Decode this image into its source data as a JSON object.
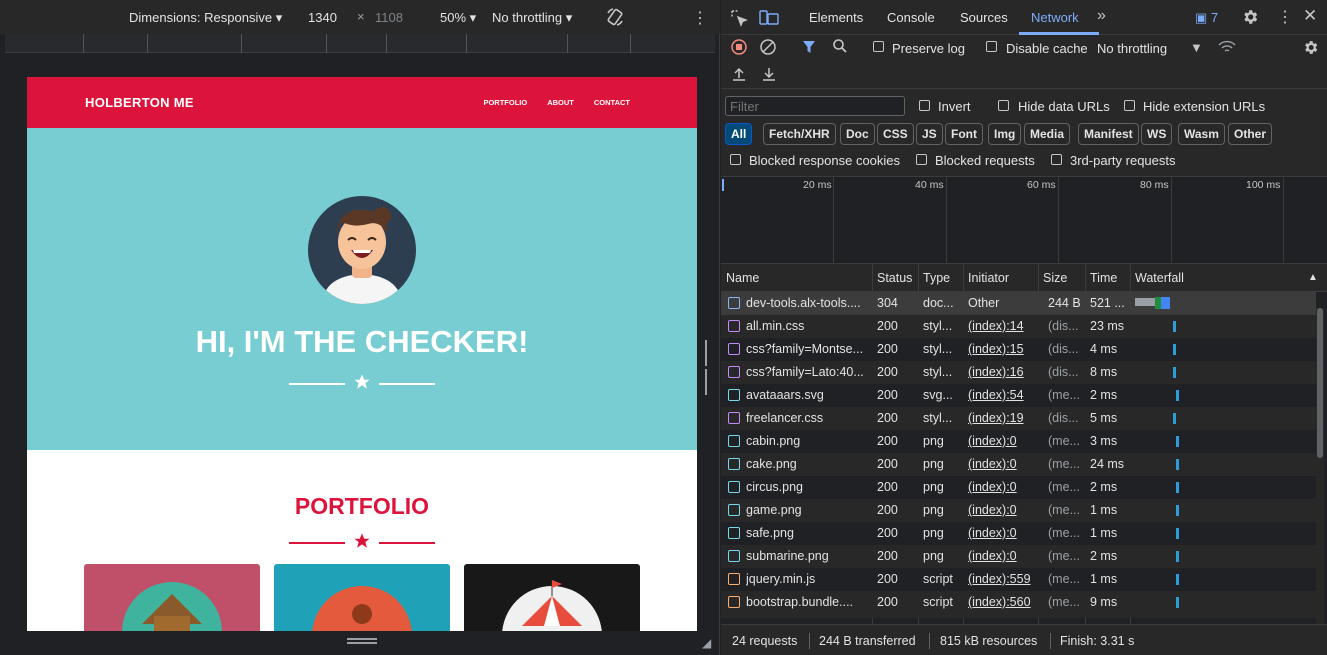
{
  "device_toolbar": {
    "dimensions_label": "Dimensions: Responsive",
    "width": "1340",
    "times": "×",
    "height": "1108",
    "zoom": "50%",
    "throttling": "No throttling"
  },
  "site": {
    "brand": "HOLBERTON ME",
    "nav": [
      "PORTFOLIO",
      "ABOUT",
      "CONTACT"
    ],
    "hero_title": "HI, I'M THE CHECKER!",
    "portfolio_title": "PORTFOLIO",
    "colors": {
      "primary": "#dc143c",
      "hero": "#78cdd2"
    }
  },
  "devtools": {
    "tabs": [
      "Elements",
      "Console",
      "Sources",
      "Network"
    ],
    "active_tab": "Network",
    "issues_count": "7",
    "toolbar": {
      "preserve_log": "Preserve log",
      "disable_cache": "Disable cache",
      "throttling": "No throttling"
    },
    "filter": {
      "placeholder": "Filter",
      "invert": "Invert",
      "hide_data_urls": "Hide data URLs",
      "hide_extension_urls": "Hide extension URLs",
      "types": [
        "All",
        "Fetch/XHR",
        "Doc",
        "CSS",
        "JS",
        "Font",
        "Img",
        "Media",
        "Manifest",
        "WS",
        "Wasm",
        "Other"
      ],
      "active_type": "All",
      "blocked_response_cookies": "Blocked response cookies",
      "blocked_requests": "Blocked requests",
      "third_party": "3rd-party requests"
    },
    "timeline_labels": [
      "20 ms",
      "40 ms",
      "60 ms",
      "80 ms",
      "100 ms"
    ],
    "columns": [
      "Name",
      "Status",
      "Type",
      "Initiator",
      "Size",
      "Time",
      "Waterfall"
    ],
    "requests": [
      {
        "name": "dev-tools.alx-tools....",
        "status": "304",
        "type": "doc...",
        "initiator": "Other",
        "size": "244 B",
        "time": "521 ...",
        "icon": "doc-icon"
      },
      {
        "name": "all.min.css",
        "status": "200",
        "type": "styl...",
        "initiator": "(index):14",
        "size": "(dis...",
        "time": "23 ms",
        "icon": "css-icon"
      },
      {
        "name": "css?family=Montse...",
        "status": "200",
        "type": "styl...",
        "initiator": "(index):15",
        "size": "(dis...",
        "time": "4 ms",
        "icon": "css-icon"
      },
      {
        "name": "css?family=Lato:40...",
        "status": "200",
        "type": "styl...",
        "initiator": "(index):16",
        "size": "(dis...",
        "time": "8 ms",
        "icon": "css-icon"
      },
      {
        "name": "avataaars.svg",
        "status": "200",
        "type": "svg...",
        "initiator": "(index):54",
        "size": "(me...",
        "time": "2 ms",
        "icon": "image-icon"
      },
      {
        "name": "freelancer.css",
        "status": "200",
        "type": "styl...",
        "initiator": "(index):19",
        "size": "(dis...",
        "time": "5 ms",
        "icon": "css-icon"
      },
      {
        "name": "cabin.png",
        "status": "200",
        "type": "png",
        "initiator": "(index):0",
        "size": "(me...",
        "time": "3 ms",
        "icon": "image-icon"
      },
      {
        "name": "cake.png",
        "status": "200",
        "type": "png",
        "initiator": "(index):0",
        "size": "(me...",
        "time": "24 ms",
        "icon": "image-icon"
      },
      {
        "name": "circus.png",
        "status": "200",
        "type": "png",
        "initiator": "(index):0",
        "size": "(me...",
        "time": "2 ms",
        "icon": "image-icon"
      },
      {
        "name": "game.png",
        "status": "200",
        "type": "png",
        "initiator": "(index):0",
        "size": "(me...",
        "time": "1 ms",
        "icon": "image-icon"
      },
      {
        "name": "safe.png",
        "status": "200",
        "type": "png",
        "initiator": "(index):0",
        "size": "(me...",
        "time": "1 ms",
        "icon": "image-icon"
      },
      {
        "name": "submarine.png",
        "status": "200",
        "type": "png",
        "initiator": "(index):0",
        "size": "(me...",
        "time": "2 ms",
        "icon": "image-icon"
      },
      {
        "name": "jquery.min.js",
        "status": "200",
        "type": "script",
        "initiator": "(index):559",
        "size": "(me...",
        "time": "1 ms",
        "icon": "script-icon"
      },
      {
        "name": "bootstrap.bundle....",
        "status": "200",
        "type": "script",
        "initiator": "(index):560",
        "size": "(me...",
        "time": "9 ms",
        "icon": "script-icon"
      }
    ],
    "status": {
      "requests": "24 requests",
      "transferred": "244 B transferred",
      "resources": "815 kB resources",
      "finish": "Finish: 3.31 s"
    }
  }
}
